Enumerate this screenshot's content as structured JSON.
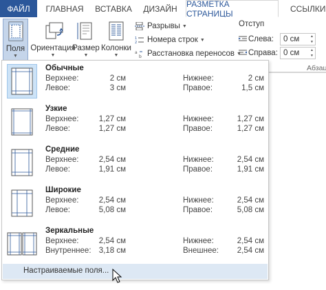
{
  "tabs": {
    "file": "ФАЙЛ",
    "home": "ГЛАВНАЯ",
    "insert": "ВСТАВКА",
    "design": "ДИЗАЙН",
    "layout": "РАЗМЕТКА СТРАНИЦЫ",
    "refs": "ССЫЛКИ"
  },
  "ribbon": {
    "margins": "Поля",
    "orientation": "Ориентация",
    "size": "Размер",
    "columns": "Колонки",
    "breaks": "Разрывы",
    "line_numbers": "Номера строк",
    "hyphenation": "Расстановка переносов",
    "indent_title": "Отступ",
    "left_label": "Слева:",
    "left_value": "0 см",
    "right_label": "Справа:",
    "right_value": "0 см",
    "paragraph_group": "Абзац"
  },
  "margins_menu": {
    "presets": [
      {
        "name": "Обычные",
        "l1": "Верхнее:",
        "v1": "2 см",
        "r1": "Нижнее:",
        "w1": "2 см",
        "l2": "Левое:",
        "v2": "3 см",
        "r2": "Правое:",
        "w2": "1,5 см",
        "selected": true,
        "icon": "margins-normal-icon"
      },
      {
        "name": "Узкие",
        "l1": "Верхнее:",
        "v1": "1,27 см",
        "r1": "Нижнее:",
        "w1": "1,27 см",
        "l2": "Левое:",
        "v2": "1,27 см",
        "r2": "Правое:",
        "w2": "1,27 см",
        "selected": false,
        "icon": "margins-narrow-icon"
      },
      {
        "name": "Средние",
        "l1": "Верхнее:",
        "v1": "2,54 см",
        "r1": "Нижнее:",
        "w1": "2,54 см",
        "l2": "Левое:",
        "v2": "1,91 см",
        "r2": "Правое:",
        "w2": "1,91 см",
        "selected": false,
        "icon": "margins-moderate-icon"
      },
      {
        "name": "Широкие",
        "l1": "Верхнее:",
        "v1": "2,54 см",
        "r1": "Нижнее:",
        "w1": "2,54 см",
        "l2": "Левое:",
        "v2": "5,08 см",
        "r2": "Правое:",
        "w2": "5,08 см",
        "selected": false,
        "icon": "margins-wide-icon"
      },
      {
        "name": "Зеркальные",
        "l1": "Верхнее:",
        "v1": "2,54 см",
        "r1": "Нижнее:",
        "w1": "2,54 см",
        "l2": "Внутреннее:",
        "v2": "3,18 см",
        "r2": "Внешнее:",
        "w2": "2,54 см",
        "selected": false,
        "icon": "margins-mirrored-icon"
      }
    ],
    "custom": "Настраиваемые поля..."
  },
  "colors": {
    "file_tab": "#2b579a",
    "accent": "#2b579a",
    "selected_bg": "#cde3f7",
    "hover_bg": "#dde8f4"
  }
}
